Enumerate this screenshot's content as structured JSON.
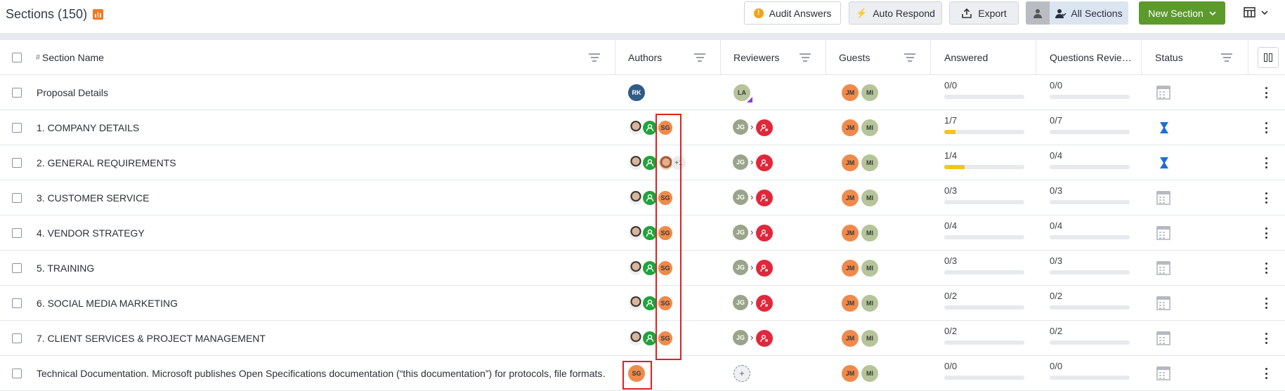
{
  "header": {
    "title": "Sections (150)",
    "audit_label": "Audit Answers",
    "auto_respond_label": "Auto Respond",
    "export_label": "Export",
    "all_sections_label": "All Sections",
    "new_section_label": "New Section"
  },
  "columns": {
    "hash": "#",
    "section_name": "Section Name",
    "authors": "Authors",
    "reviewers": "Reviewers",
    "guests": "Guests",
    "answered": "Answered",
    "questions_reviewed": "Questions Revie…",
    "status": "Status"
  },
  "rows": [
    {
      "name": "Proposal Details",
      "author_initials": "RK",
      "reviewer_initials": "LA",
      "guests": [
        "JM",
        "MI"
      ],
      "answered": "0/0",
      "answered_progress": 0,
      "reviewed": "0/0",
      "status": "calendar-icon"
    },
    {
      "name": "1. COMPANY DETAILS",
      "author_initials": "SG",
      "reviewer_initials": "JG",
      "guests": [
        "JM",
        "MI"
      ],
      "answered": "1/7",
      "answered_progress": 0.143,
      "reviewed": "0/7",
      "status": "hourglass-icon"
    },
    {
      "name": "2. GENERAL REQUIREMENTS",
      "author_more": "+1",
      "reviewer_initials": "JG",
      "guests": [
        "JM",
        "MI"
      ],
      "answered": "1/4",
      "answered_progress": 0.25,
      "reviewed": "0/4",
      "status": "hourglass-icon"
    },
    {
      "name": "3. CUSTOMER SERVICE",
      "author_initials": "SG",
      "reviewer_initials": "JG",
      "guests": [
        "JM",
        "MI"
      ],
      "answered": "0/3",
      "answered_progress": 0,
      "reviewed": "0/3",
      "status": "calendar-icon"
    },
    {
      "name": "4. VENDOR STRATEGY",
      "author_initials": "SG",
      "reviewer_initials": "JG",
      "guests": [
        "JM",
        "MI"
      ],
      "answered": "0/4",
      "answered_progress": 0,
      "reviewed": "0/4",
      "status": "calendar-icon"
    },
    {
      "name": "5. TRAINING",
      "author_initials": "SG",
      "reviewer_initials": "JG",
      "guests": [
        "JM",
        "MI"
      ],
      "answered": "0/3",
      "answered_progress": 0,
      "reviewed": "0/3",
      "status": "calendar-icon"
    },
    {
      "name": "6. SOCIAL MEDIA MARKETING",
      "author_initials": "SG",
      "reviewer_initials": "JG",
      "guests": [
        "JM",
        "MI"
      ],
      "answered": "0/2",
      "answered_progress": 0,
      "reviewed": "0/2",
      "status": "calendar-icon"
    },
    {
      "name": "7. CLIENT SERVICES & PROJECT MANAGEMENT",
      "author_initials": "SG",
      "reviewer_initials": "JG",
      "guests": [
        "JM",
        "MI"
      ],
      "answered": "0/2",
      "answered_progress": 0,
      "reviewed": "0/2",
      "status": "calendar-icon"
    },
    {
      "name": "Technical Documentation. Microsoft publishes Open Specifications documentation (“this documentation”) for protocols, file formats…",
      "author_initials": "SG",
      "reviewer_add": "+",
      "guests": [
        "JM",
        "MI"
      ],
      "answered": "0/0",
      "answered_progress": 0,
      "reviewed": "0/0",
      "status": "calendar-icon"
    }
  ],
  "colors": {
    "accent_green": "#5b9a2b",
    "progress": "#f5c518",
    "highlight": "#e02020",
    "status_blue": "#1f6fd1"
  }
}
